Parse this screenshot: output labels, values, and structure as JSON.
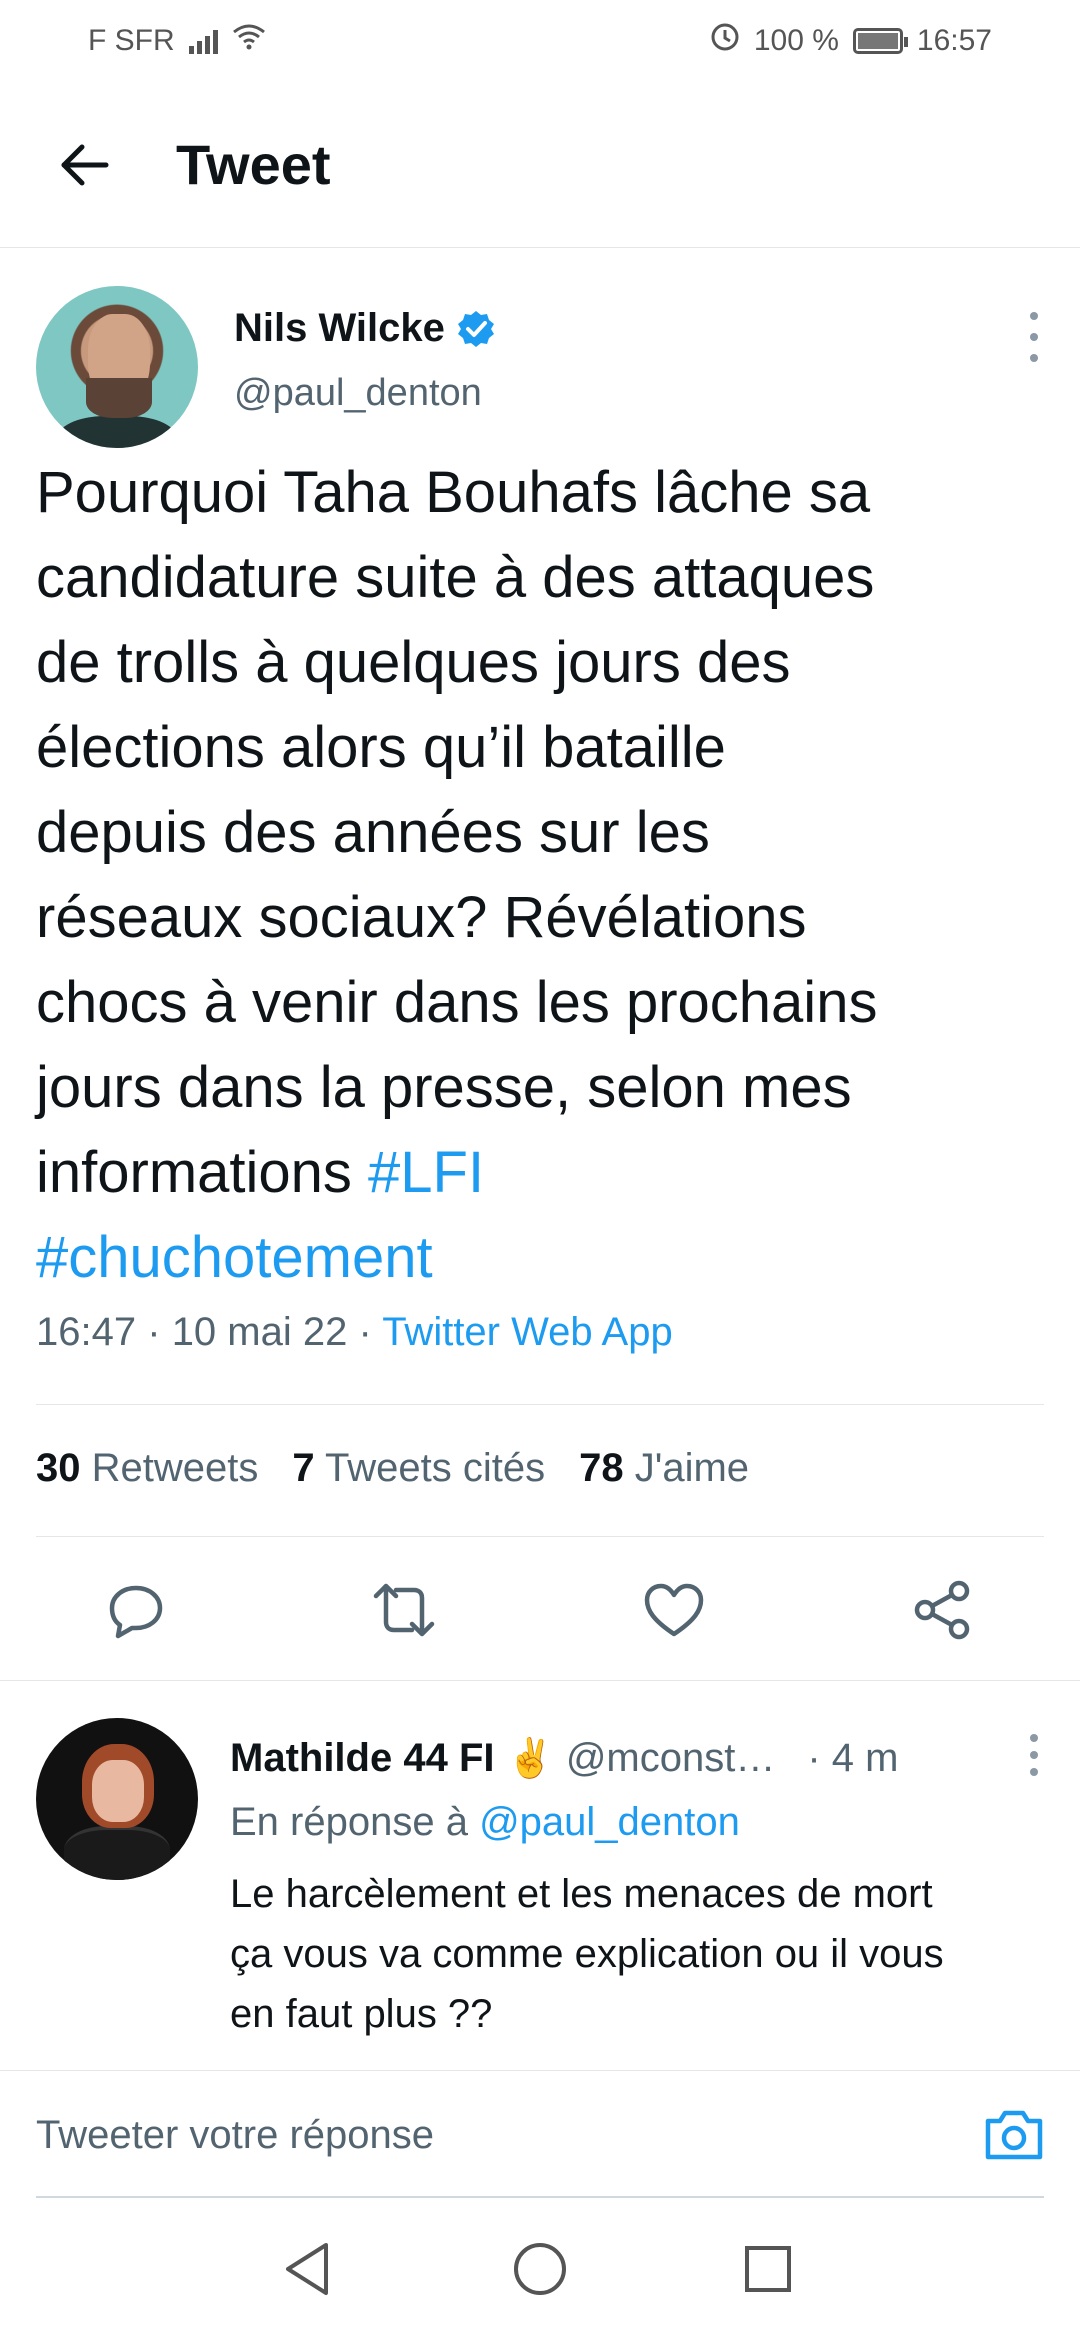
{
  "status_bar": {
    "carrier": "F SFR",
    "battery_percent": "100 %",
    "time": "16:57",
    "icons": [
      "signal-icon",
      "wifi-icon",
      "data-saver-icon",
      "battery-icon"
    ]
  },
  "header": {
    "back_icon": "arrow-left-icon",
    "title": "Tweet"
  },
  "tweet": {
    "author_name": "Nils Wilcke",
    "author_handle": "@paul_denton",
    "verified": true,
    "text_lines": [
      "Pourquoi Taha Bouhafs lâche sa",
      "candidature suite à des attaques",
      "de trolls à quelques jours des",
      "élections alors qu’il bataille",
      "depuis des années sur les",
      "réseaux sociaux? Révélations",
      "chocs à venir dans les prochains",
      "jours dans la presse, selon mes"
    ],
    "text_last_prefix": "informations ",
    "hashtag_1": "#LFI",
    "hashtag_2": "#chuchotement",
    "time": "16:47",
    "date": "10 mai 22",
    "source": "Twitter Web App",
    "separator": "·",
    "stats": {
      "retweets_count": "30",
      "retweets_label": "Retweets",
      "quotes_count": "7",
      "quotes_label": "Tweets cités",
      "likes_count": "78",
      "likes_label": "J'aime"
    },
    "actions": [
      "reply-icon",
      "retweet-icon",
      "like-icon",
      "share-icon"
    ]
  },
  "reply": {
    "author_name": "Mathilde 44 FI",
    "emoji": "✌️",
    "author_handle": "@mconst…",
    "time": "· 4 m",
    "reply_to_prefix": "En réponse à ",
    "reply_to_handle": "@paul_denton",
    "text_lines": [
      "Le harcèlement et les menaces de mort",
      "ça vous va comme explication ou il vous",
      "en faut plus ??"
    ]
  },
  "compose": {
    "placeholder": "Tweeter votre réponse",
    "camera_icon": "camera-icon"
  },
  "navbar": {
    "icons": [
      "back-triangle-icon",
      "home-circle-icon",
      "recents-square-icon"
    ]
  },
  "colors": {
    "accent": "#1d9bf0",
    "text": "#0f1419",
    "secondary": "#536471"
  }
}
